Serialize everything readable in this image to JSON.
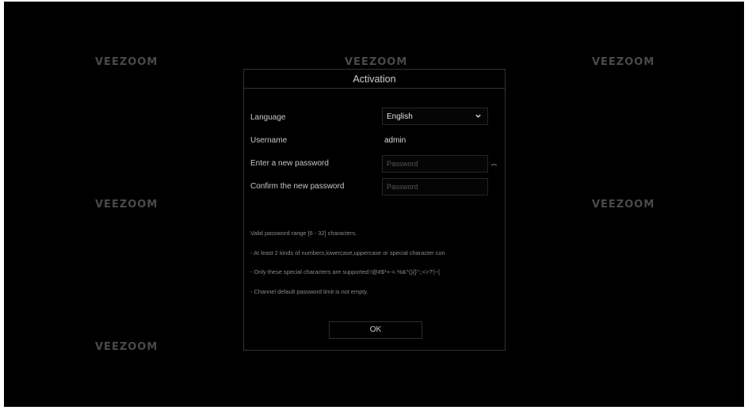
{
  "watermark": {
    "text": "VEEZOOM"
  },
  "dialog": {
    "title": "Activation",
    "language": {
      "label": "Language",
      "value": "English",
      "icon": "chevron-down-icon"
    },
    "username": {
      "label": "Username",
      "value": "admin"
    },
    "new_password": {
      "label": "Enter a new password",
      "placeholder": "Password",
      "icon": "eye-icon"
    },
    "confirm_password": {
      "label": "Confirm the new password",
      "placeholder": "Password"
    },
    "rules": [
      "Valid password range [6 - 32] characters.",
      "- At least 2 kinds of numbers,lowercase,uppercase or special character con",
      "- Only these special characters are supported:!@#$*+-=.%&^(){}'':;<>?'|~[",
      "- Channel default password limit is not empty."
    ],
    "ok_label": "OK"
  },
  "colors": {
    "background": "#000000",
    "text": "#cfcfcf",
    "muted": "#8a8a8a",
    "border": "#333333"
  }
}
